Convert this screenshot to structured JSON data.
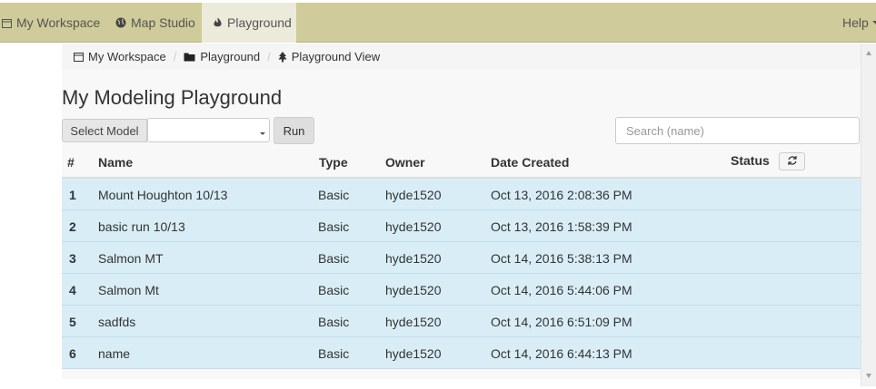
{
  "nav": {
    "items": [
      {
        "label": "My Workspace",
        "icon": "calendar-icon"
      },
      {
        "label": "Map Studio",
        "icon": "globe-icon"
      },
      {
        "label": "Playground",
        "icon": "fire-icon",
        "active": true
      }
    ],
    "help_label": "Help"
  },
  "breadcrumb": [
    {
      "label": "My Workspace",
      "icon": "calendar-icon"
    },
    {
      "label": "Playground",
      "icon": "folder-icon"
    },
    {
      "label": "Playground View",
      "icon": "tree-icon"
    }
  ],
  "page": {
    "title": "My Modeling Playground",
    "select_label": "Select Model",
    "select_value": "",
    "run_label": "Run",
    "search_placeholder": "Search (name)"
  },
  "table": {
    "headers": {
      "num": "#",
      "name": "Name",
      "type": "Type",
      "owner": "Owner",
      "date": "Date Created",
      "status": "Status"
    },
    "rows": [
      {
        "num": "1",
        "name": "Mount Houghton 10/13",
        "type": "Basic",
        "owner": "hyde1520",
        "date": "Oct 13, 2016 2:08:36 PM",
        "status": ""
      },
      {
        "num": "2",
        "name": "basic run 10/13",
        "type": "Basic",
        "owner": "hyde1520",
        "date": "Oct 13, 2016 1:58:39 PM",
        "status": ""
      },
      {
        "num": "3",
        "name": "Salmon MT",
        "type": "Basic",
        "owner": "hyde1520",
        "date": "Oct 14, 2016 5:38:13 PM",
        "status": ""
      },
      {
        "num": "4",
        "name": "Salmon Mt",
        "type": "Basic",
        "owner": "hyde1520",
        "date": "Oct 14, 2016 5:44:06 PM",
        "status": ""
      },
      {
        "num": "5",
        "name": "sadfds",
        "type": "Basic",
        "owner": "hyde1520",
        "date": "Oct 14, 2016 6:51:09 PM",
        "status": ""
      },
      {
        "num": "6",
        "name": "name",
        "type": "Basic",
        "owner": "hyde1520",
        "date": "Oct 14, 2016 6:44:13 PM",
        "status": ""
      }
    ]
  },
  "colors": {
    "nav_bg": "#cfcb9a",
    "nav_active": "#eceadb",
    "row_bg": "#d9edf7"
  }
}
